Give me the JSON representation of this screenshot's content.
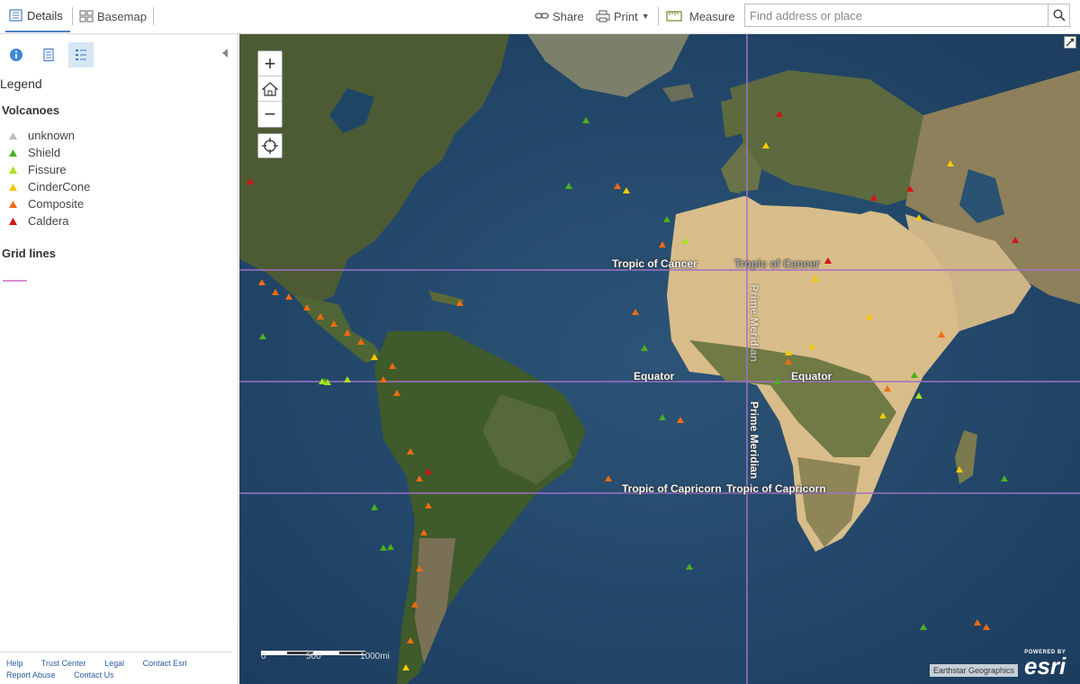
{
  "toolbar": {
    "details": "Details",
    "basemap": "Basemap",
    "share": "Share",
    "print": "Print",
    "measure": "Measure",
    "search_placeholder": "Find address or place"
  },
  "panel": {
    "legend_title": "Legend",
    "layer_title": "Volcanoes",
    "legend_items": [
      {
        "label": "unknown",
        "color": "#bdbdbd"
      },
      {
        "label": "Shield",
        "color": "#4caf1e"
      },
      {
        "label": "Fissure",
        "color": "#a8e020"
      },
      {
        "label": "CinderCone",
        "color": "#f5c800"
      },
      {
        "label": "Composite",
        "color": "#f26a10"
      },
      {
        "label": "Caldera",
        "color": "#d41414"
      }
    ],
    "grid_title": "Grid lines",
    "grid_color": "#d98fd9",
    "footer_row1": [
      "Help",
      "Trust Center",
      "Legal",
      "Contact Esri"
    ],
    "footer_row2": [
      "Report Abuse",
      "Contact Us"
    ]
  },
  "map": {
    "zoom_in": "+",
    "zoom_out": "−",
    "grid_labels": {
      "tropic_cancer_left": "Tropic of Cancer",
      "tropic_cancer_right": "Tropic of Cancer",
      "equator_left": "Equator",
      "equator_right": "Equator",
      "tropic_capricorn_left": "Tropic of Capricorn",
      "tropic_capricorn_right": "Tropic of Capricorn",
      "prime_meridian_top": "Prime Meridian",
      "prime_meridian_bottom": "Prime Meridian"
    },
    "scale_labels": [
      "0",
      "500",
      "1000mi"
    ],
    "attribution": "Earthstar Geographics",
    "esri_powered": "POWERED BY",
    "esri_logo": "esri"
  }
}
